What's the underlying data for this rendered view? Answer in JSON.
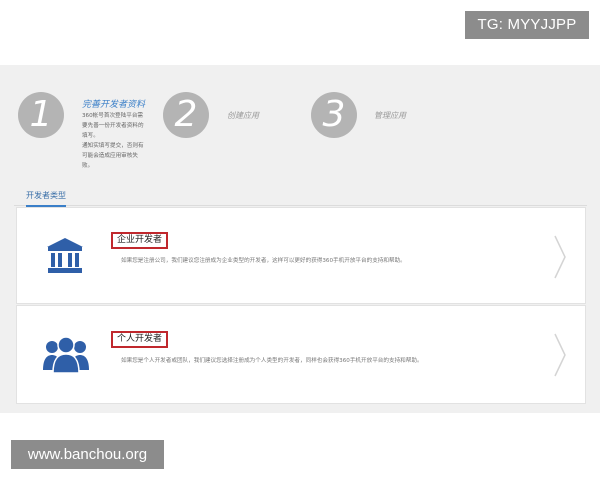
{
  "watermarks": {
    "top": "TG: MYYJJPP",
    "bottom": "www.banchou.org"
  },
  "steps": [
    {
      "number": "1",
      "title": "完善开发者资料",
      "description": [
        "360帐号首次登陆平台需",
        "要先善一份开发者资料的",
        "填写。",
        "通知实填写提交，否则有",
        "可能会造成应用审核失",
        "败。"
      ]
    },
    {
      "number": "2",
      "title": "创建应用"
    },
    {
      "number": "3",
      "title": "管理应用"
    }
  ],
  "tab": {
    "label": "开发者类型"
  },
  "cards": [
    {
      "title": "企业开发者",
      "description": "如果您是注册公司，我们建议您注册成为企业类型的开发者，这样可以更好的获得360手机开放平台的支持和帮助。",
      "icon": "bank-icon"
    },
    {
      "title": "个人开发者",
      "description": "如果您是个人开发者或团队，我们建议您选择注册成为个人类型的开发者，同样也会获得360手机开放平台的支持和帮助。",
      "icon": "users-icon"
    }
  ],
  "colors": {
    "accent": "#3a7fc8",
    "highlight_border": "#c0282d",
    "icon_blue": "#2f5fa8",
    "step_circle": "#b4b4b4"
  }
}
